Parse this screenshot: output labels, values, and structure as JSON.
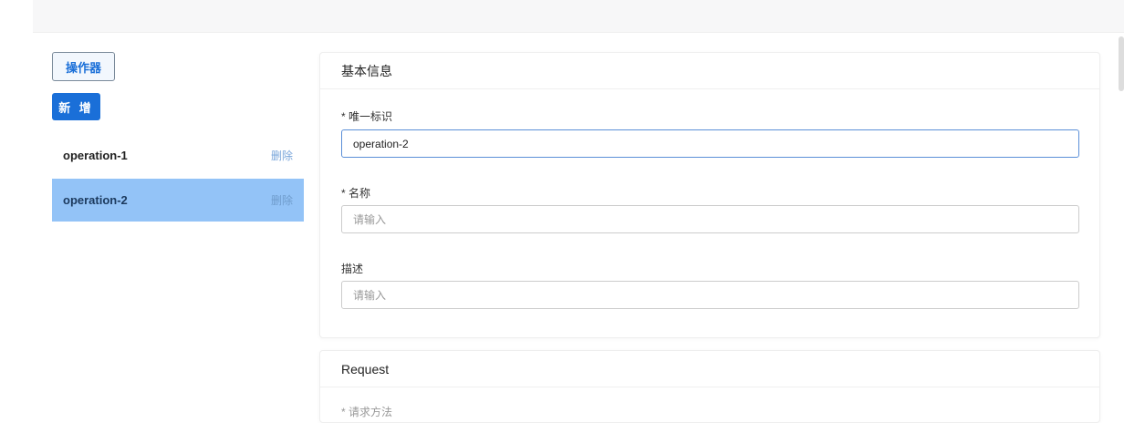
{
  "sidebar": {
    "operator_button": "操作器",
    "add_button": "新 增",
    "items": [
      {
        "label": "operation-1",
        "delete": "删除"
      },
      {
        "label": "operation-2",
        "delete": "删除"
      }
    ]
  },
  "basic": {
    "title": "基本信息",
    "id_label": "* 唯一标识",
    "id_value": "operation-2",
    "name_label": "* 名称",
    "name_placeholder": "请输入",
    "desc_label": "描述",
    "desc_placeholder": "请输入"
  },
  "request": {
    "title": "Request",
    "first_label": "* 请求方法"
  }
}
